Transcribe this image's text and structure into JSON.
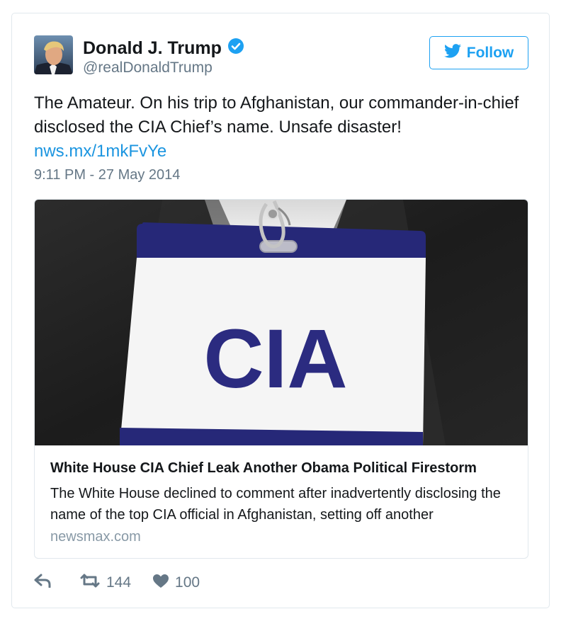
{
  "tweet": {
    "author": {
      "name": "Donald J. Trump",
      "handle": "@realDonaldTrump",
      "verified_icon": "verified-badge-icon"
    },
    "follow_button": {
      "label": "Follow",
      "icon": "twitter-bird-icon"
    },
    "text": "The Amateur. On his trip to Afghanistan, our commander-in-chief disclosed the CIA Chief’s name. Unsafe disaster!",
    "link": "nws.mx/1mkFvYe",
    "timestamp": "9:11 PM - 27 May 2014",
    "card": {
      "image_badge_text": "CIA",
      "title": "White House CIA Chief Leak Another Obama Political Firestorm",
      "description": "The White House declined to comment after inadvertently disclosing the name of the top CIA official in Afghanistan, setting off another",
      "domain": "newsmax.com"
    },
    "actions": {
      "reply_icon": "reply-icon",
      "retweet_icon": "retweet-icon",
      "retweet_count": "144",
      "like_icon": "heart-icon",
      "like_count": "100"
    }
  },
  "colors": {
    "accent": "#1da1f2",
    "link": "#1b95e0",
    "secondary_text": "#657786",
    "badge_blue": "#2b2b80"
  }
}
